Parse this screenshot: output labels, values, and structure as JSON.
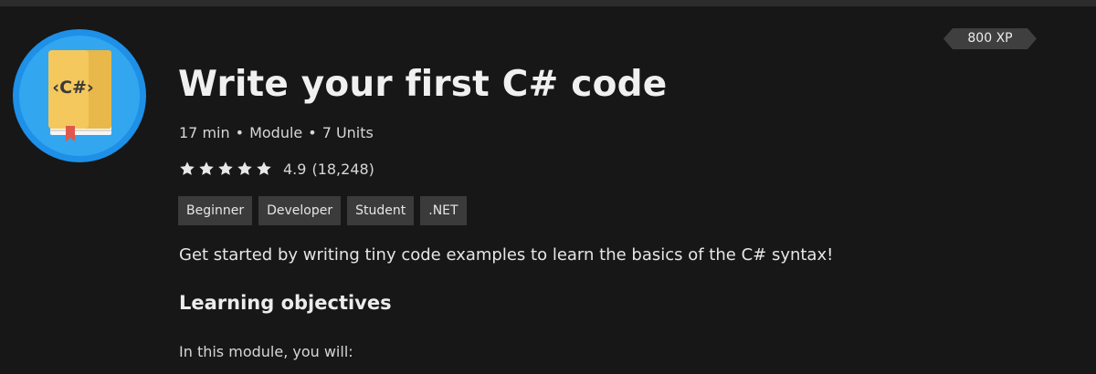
{
  "module": {
    "title": "Write your first C# code",
    "duration": "17 min",
    "type": "Module",
    "units": "7 Units",
    "xp": "800 XP",
    "rating_value": "4.9",
    "rating_count": "(18,248)",
    "star_count": 5,
    "icon": "book-icon",
    "icon_label": "‹C#›",
    "tags": [
      "Beginner",
      "Developer",
      "Student",
      ".NET"
    ],
    "summary": "Get started by writing tiny code examples to learn the basics of the C# syntax!",
    "objectives_heading": "Learning objectives",
    "objectives_intro": "In this module, you will:"
  },
  "colors": {
    "background": "#171717",
    "badge_ring": "#1e90e8",
    "badge_fill": "#33a6f0",
    "book": "#f4c85d",
    "xp_tag": "#3f3f3f",
    "tag_bg": "#3b3b3b",
    "star": "#e8e8e8"
  }
}
